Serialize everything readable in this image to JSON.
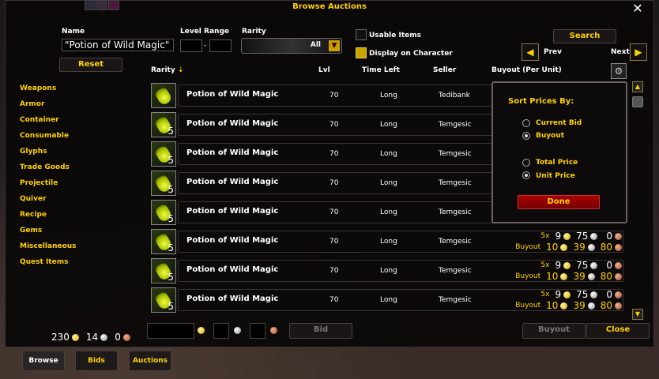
{
  "window": {
    "title": "Browse Auctions",
    "close_symbol": "✕"
  },
  "filters": {
    "name_label": "Name",
    "name_value": "\"Potion of Wild Magic\"",
    "level_range_label": "Level Range",
    "level_sep": "-",
    "rarity_label": "Rarity",
    "rarity_value": "All",
    "reset_label": "Reset",
    "usable_items_label": "Usable Items",
    "display_on_character_label": "Display on Character",
    "search_label": "Search",
    "prev_label": "Prev",
    "next_label": "Next"
  },
  "categories": [
    "Weapons",
    "Armor",
    "Container",
    "Consumable",
    "Glyphs",
    "Trade Goods",
    "Projectile",
    "Quiver",
    "Recipe",
    "Gems",
    "Miscellaneous",
    "Quest Items"
  ],
  "columns": {
    "rarity": "Rarity",
    "lvl": "Lvl",
    "time_left": "Time Left",
    "seller": "Seller",
    "buyout": "Buyout (Per Unit)"
  },
  "rows": [
    {
      "count": "",
      "name": "Potion of Wild Magic",
      "lvl": "70",
      "time": "Long",
      "seller": "Tedibank"
    },
    {
      "count": "5",
      "name": "Potion of Wild Magic",
      "lvl": "70",
      "time": "Long",
      "seller": "Temgesic"
    },
    {
      "count": "5",
      "name": "Potion of Wild Magic",
      "lvl": "70",
      "time": "Long",
      "seller": "Temgesic"
    },
    {
      "count": "5",
      "name": "Potion of Wild Magic",
      "lvl": "70",
      "time": "Long",
      "seller": "Temgesic"
    },
    {
      "count": "5",
      "name": "Potion of Wild Magic",
      "lvl": "70",
      "time": "Long",
      "seller": "Temgesic"
    },
    {
      "count": "5",
      "name": "Potion of Wild Magic",
      "lvl": "70",
      "time": "Long",
      "seller": "Temgesic",
      "qty": "5x",
      "bid": [
        "9",
        "75",
        "0"
      ],
      "buyout_label": "Buyout",
      "buyout": [
        "10",
        "39",
        "80"
      ]
    },
    {
      "count": "5",
      "name": "Potion of Wild Magic",
      "lvl": "70",
      "time": "Long",
      "seller": "Temgesic",
      "qty": "5x",
      "bid": [
        "9",
        "75",
        "0"
      ],
      "buyout_label": "Buyout",
      "buyout": [
        "10",
        "39",
        "80"
      ]
    },
    {
      "count": "5",
      "name": "Potion of Wild Magic",
      "lvl": "70",
      "time": "Long",
      "seller": "Temgesic",
      "qty": "5x",
      "bid": [
        "9",
        "75",
        "0"
      ],
      "buyout_label": "Buyout",
      "buyout": [
        "10",
        "39",
        "80"
      ]
    }
  ],
  "sort_popup": {
    "title": "Sort Prices By:",
    "current_bid": "Current Bid",
    "buyout": "Buyout",
    "total_price": "Total Price",
    "unit_price": "Unit Price",
    "done": "Done"
  },
  "footer": {
    "gold": "230",
    "silver": "14",
    "copper": "0",
    "bid_label": "Bid",
    "buyout_label": "Buyout",
    "close_label": "Close"
  },
  "tabs": [
    "Browse",
    "Bids",
    "Auctions"
  ],
  "colors": {
    "gold_text": "#ffd100",
    "done_red": "#a00000"
  }
}
